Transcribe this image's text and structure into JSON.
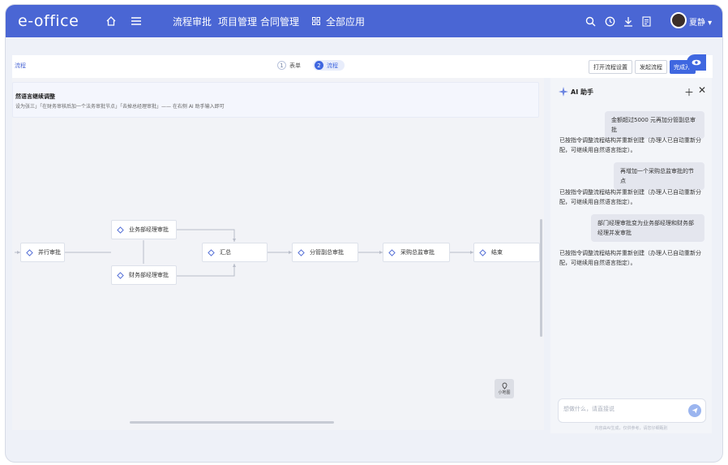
{
  "header": {
    "logo": "e-office",
    "nav": [
      "流程审批",
      "项目管理",
      "合同管理"
    ],
    "all_apps": "全部应用",
    "user_name": "夏静"
  },
  "toolbar": {
    "left_label": "流程",
    "steps": [
      {
        "num": "1",
        "label": "表单"
      },
      {
        "num": "2",
        "label": "流程"
      }
    ],
    "open_settings": "打开流程设置",
    "start_flow": "发起流程",
    "complete": "完成开"
  },
  "banner": {
    "title": "然语言继续调整",
    "subtitle": "设为张三」「在财务审核后加一个法务审批节点」「去掉总经理审批」—— 在右侧 AI 助手输入即可"
  },
  "flow": {
    "nodes": [
      "并行审批",
      "业务部经理审批",
      "财务部经理审批",
      "汇总",
      "分管副总审批",
      "采购总监审批",
      "结束"
    ]
  },
  "minimap_label": "小地图",
  "ai": {
    "title": "AI 助手",
    "messages": [
      {
        "role": "user",
        "text": "金额超过5000 元再加分管副总审批"
      },
      {
        "role": "bot",
        "text": "已按指令调整流程结构并重新创建（办理人已自动重新分配，可继续用自然语言指定）。"
      },
      {
        "role": "user",
        "text": "再增加一个采购总监审批的节点"
      },
      {
        "role": "bot",
        "text": "已按指令调整流程结构并重新创建（办理人已自动重新分配，可继续用自然语言指定）。"
      },
      {
        "role": "user",
        "text": "部门经理审批变为业务部经理和财务部经理并发审批"
      },
      {
        "role": "bot",
        "text": "已按指令调整流程结构并重新创建（办理人已自动重新分配，可继续用自然语言指定）。"
      }
    ],
    "input_placeholder": "想做什么，请直接说",
    "footer": "内容由AI生成，仅供参考，请您仔细甄别"
  },
  "colors": {
    "brand": "#4a66d4",
    "primary": "#3f67e0"
  }
}
